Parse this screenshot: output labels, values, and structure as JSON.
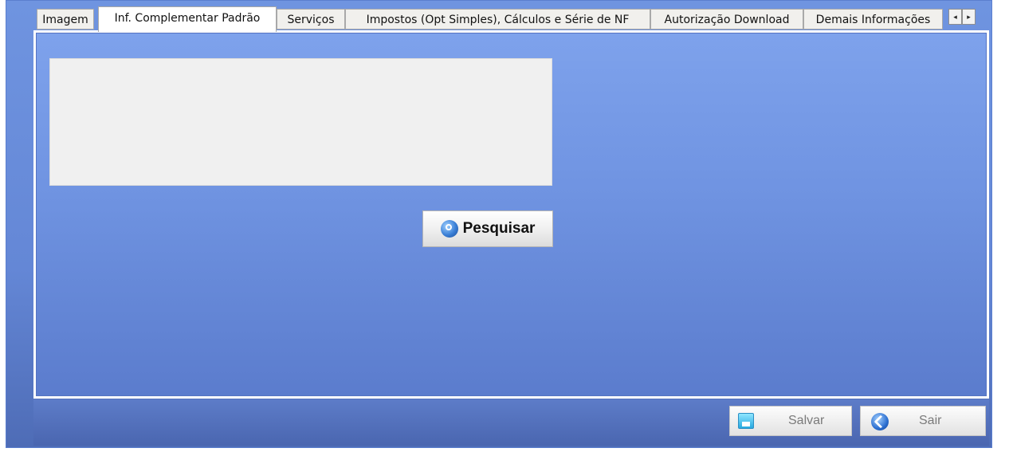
{
  "tabs": [
    {
      "label": "Imagem",
      "active": false
    },
    {
      "label": "Inf. Complementar Padrão",
      "active": true
    },
    {
      "label": "Serviços",
      "active": false
    },
    {
      "label": "Impostos (Opt Simples), Cálculos e Série de NF",
      "active": false
    },
    {
      "label": "Autorização Download",
      "active": false
    },
    {
      "label": "Demais Informações",
      "active": false
    }
  ],
  "tab_scroll": {
    "left": "◂",
    "right": "▸"
  },
  "panel": {
    "text_value": "",
    "search_button": "Pesquisar"
  },
  "footer": {
    "save_label": "Salvar",
    "exit_label": "Sair"
  }
}
